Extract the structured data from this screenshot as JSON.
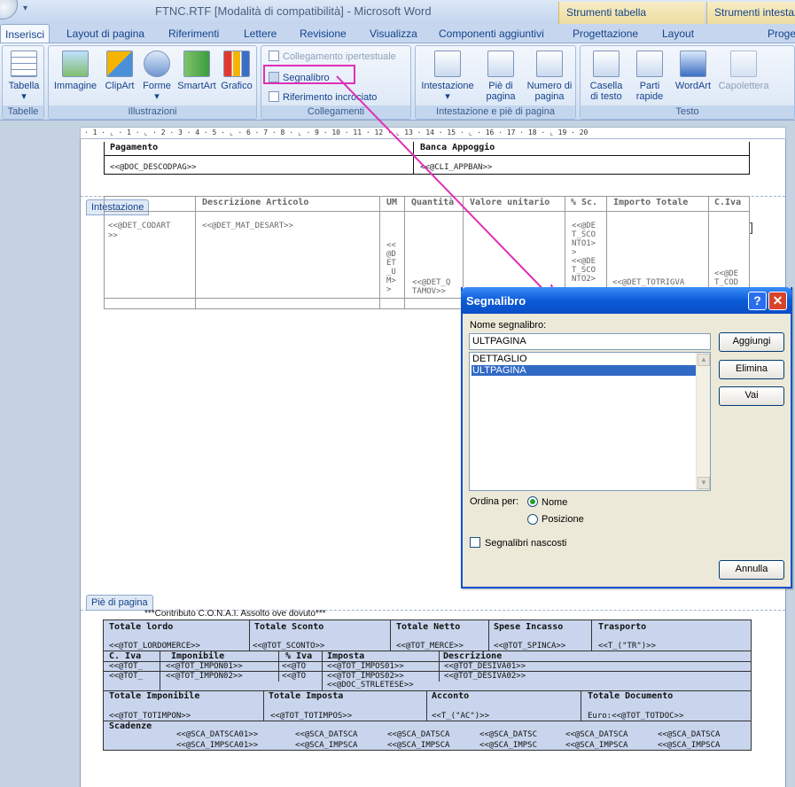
{
  "window": {
    "title": "FTNC.RTF [Modalità di compatibilità] - Microsoft Word",
    "quick_access": "▾"
  },
  "contextual_tabs": [
    "Strumenti tabella",
    "Strumenti intestaz"
  ],
  "tabs": [
    "Inserisci",
    "Layout di pagina",
    "Riferimenti",
    "Lettere",
    "Revisione",
    "Visualizza",
    "Componenti aggiuntivi",
    "Progettazione",
    "Layout",
    "Proge"
  ],
  "ribbon": {
    "groups": {
      "tabelle": {
        "label": "Tabelle",
        "items": [
          "Tabella"
        ]
      },
      "illustrazioni": {
        "label": "Illustrazioni",
        "items": [
          "Immagine",
          "ClipArt",
          "Forme",
          "SmartArt",
          "Grafico"
        ]
      },
      "collegamenti": {
        "label": "Collegamenti",
        "items": [
          "Collegamento ipertestuale",
          "Segnalibro",
          "Riferimento incrociato"
        ]
      },
      "intestazione": {
        "label": "Intestazione e piè di pagina",
        "items": [
          "Intestazione",
          "Piè di",
          "pagina",
          "Numero di",
          "pagina"
        ]
      },
      "testo": {
        "label": "Testo",
        "items": [
          "Casella",
          "di testo",
          "Parti",
          "rapide",
          "WordArt",
          "Capolettera"
        ]
      }
    },
    "dropdown_mark": "▾"
  },
  "ruler": "· 1 · ⌞ · 1 · ⌞ · 2 · 3 · 4 · 5 · ⌞ · 6 · 7 · 8 · ⌞ · 9 · 10 · 11 · 12 · ⌞ 13 · 14 · 15 · ⌞ · 16 · 17 · 18 · ⌞ 19 · 20",
  "document": {
    "top_table": {
      "headers": [
        "Pagamento",
        "Banca Appoggio"
      ],
      "values": [
        "<<@DOC_DESCODPAG>>",
        "<<@CLI_APPBAN>>"
      ]
    },
    "header_tag": "Intestazione",
    "footer_tag": "Piè di pagina",
    "detail_table": {
      "headers": [
        "Descrizione Articolo",
        "UM",
        "Quantità",
        "Valore unitario",
        "% Sc.",
        "Importo Totale",
        "C.Iva"
      ],
      "codart": "<<@DET_CODART",
      "codart2": ">>",
      "desart": "<<@DET_MAT_DESART>>",
      "um": [
        "<<",
        "@D",
        "ET",
        "_U",
        "M>",
        ">"
      ],
      "qta": [
        "<<@DET_Q",
        "TAMOV>>"
      ],
      "sconto": [
        "<<@DE",
        "T_SCO",
        "NTO1>",
        ">",
        "<<@DE",
        "T_SCO",
        "NTO2>"
      ],
      "totrigva": "<<@DET_TOTRIGVA",
      "cod": [
        "<<@DE",
        "T_COD"
      ],
      "bracket": "]"
    },
    "footer": {
      "conai": "***Contributo C.O.N.A.I. Assolto ove dovuto***",
      "row1_headers": [
        "Totale lordo",
        "Totale Sconto",
        "Totale Netto",
        "Spese Incasso",
        "Trasporto"
      ],
      "row1_values": [
        "<<@TOT_LORDOMERCE>>",
        "<<@TOT_SCONTO>>",
        "<<@TOT_MERCE>>",
        "<<@TOT_SPINCA>>",
        "<<T_(\"TR\")>>"
      ],
      "row2_headers": [
        "C. Iva",
        "Imponibile",
        "% Iva",
        "Imposta",
        "Descrizione"
      ],
      "row2_values_a": [
        "<<@TOT_",
        "<<@TOT_IMPON01>>",
        "<<@TO",
        "<<@TOT_IMPOS01>>",
        "<<@TOT_DESIVA01>>"
      ],
      "row2_values_b": [
        "<<@TOT_",
        "<<@TOT_IMPON02>>",
        "<<@TO",
        "<<@TOT_IMPOS02>>",
        "<<@TOT_DESIVA02>>"
      ],
      "strletese": "<<@DOC_STRLETESE>>",
      "row3_headers": [
        "Totale Imponibile",
        "Totale Imposta",
        "Acconto",
        "Totale Documento"
      ],
      "row3_values": [
        "<<@TOT_TOTIMPON>>",
        "<<@TOT_TOTIMPOS>>",
        "<<T_(\"AC\")>>",
        "Euro:<<@TOT_TOTDOC>>"
      ],
      "scadenze_label": "Scadenze",
      "scadenze_dates": [
        "<<@SCA_DATSCA01>>",
        "<<@SCA_DATSCA",
        "<<@SCA_DATSCA",
        "<<@SCA_DATSC",
        "<<@SCA_DATSCA",
        "<<@SCA_DATSCA"
      ],
      "scadenze_amounts": [
        "<<@SCA_IMPSCA01>>",
        "<<@SCA_IMPSCA",
        "<<@SCA_IMPSCA",
        "<<@SCA_IMPSC",
        "<<@SCA_IMPSCA",
        "<<@SCA_IMPSCA"
      ]
    }
  },
  "dialog": {
    "title": "Segnalibro",
    "help": "?",
    "close": "✕",
    "name_label": "Nome segnalibro:",
    "name_value": "ULTPAGINA",
    "bookmarks": [
      "DETTAGLIO",
      "ULTPAGINA"
    ],
    "selected_index": 1,
    "sort_label": "Ordina per:",
    "sort_options": [
      "Nome",
      "Posizione"
    ],
    "sort_selected": "Nome",
    "hidden_label": "Segnalibri nascosti",
    "hidden_checked": false,
    "buttons": {
      "add": "Aggiungi",
      "delete": "Elimina",
      "goto": "Vai",
      "cancel": "Annulla"
    }
  },
  "colors": {
    "annotation": "#e02fb6",
    "dialog_title": "#0b5bd8",
    "selection": "#316ac5"
  }
}
